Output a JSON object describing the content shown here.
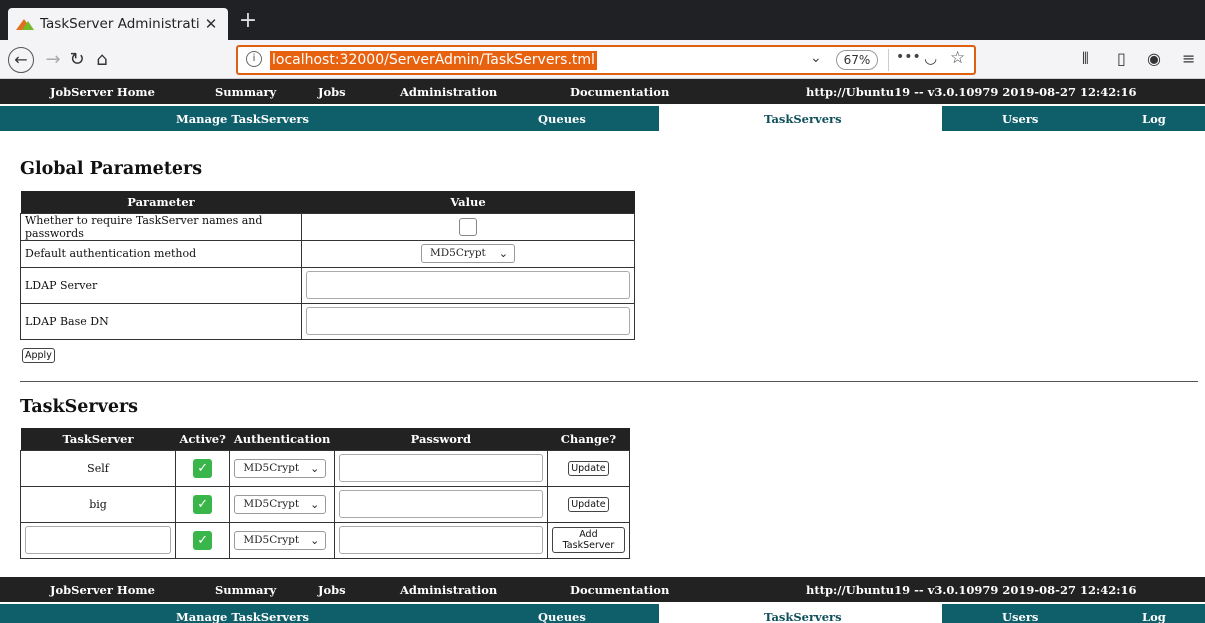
{
  "browser": {
    "tab_title": "TaskServer Administrati",
    "tab_close": "✕",
    "new_tab": "+",
    "url": "localhost:32000/ServerAdmin/TaskServers.tml",
    "zoom": "67%"
  },
  "topnav": {
    "home": "JobServer Home",
    "summary": "Summary",
    "jobs": "Jobs",
    "administration": "Administration",
    "documentation": "Documentation",
    "server_info": "http://Ubuntu19 -- v3.0.10979  2019-08-27 12:42:16"
  },
  "subnav": {
    "manage": "Manage TaskServers",
    "queues": "Queues",
    "taskservers": "TaskServers",
    "users": "Users",
    "log": "Log"
  },
  "global": {
    "heading": "Global Parameters",
    "col_parameter": "Parameter",
    "col_value": "Value",
    "row_require": "Whether to require TaskServer names and passwords",
    "row_auth": "Default authentication method",
    "auth_value": "MD5Crypt",
    "row_ldap_server": "LDAP Server",
    "row_ldap_base": "LDAP Base DN",
    "apply": "Apply"
  },
  "taskservers": {
    "heading": "TaskServers",
    "columns": [
      "TaskServer",
      "Active?",
      "Authentication",
      "Password",
      "Change?"
    ],
    "rows": [
      {
        "name": "Self",
        "auth": "MD5Crypt",
        "action": "Update"
      },
      {
        "name": "big",
        "auth": "MD5Crypt",
        "action": "Update"
      },
      {
        "name": "",
        "auth": "MD5Crypt",
        "action": "Add TaskServer"
      }
    ]
  },
  "colors": {
    "nav_dark": "#222222",
    "nav_teal": "#0f5f6a",
    "check_green": "#39b54a",
    "url_highlight": "#e8610f"
  }
}
